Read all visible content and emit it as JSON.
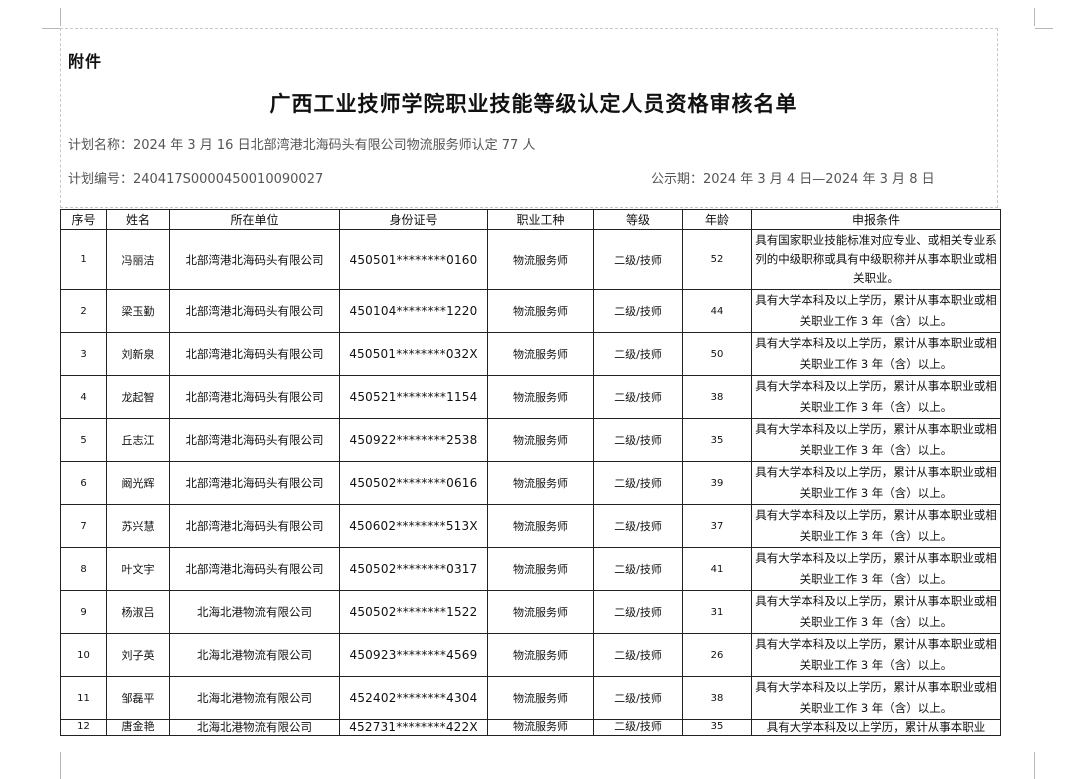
{
  "document": {
    "attachment_label": "附件",
    "title": "广西工业技师学院职业技能等级认定人员资格审核名单",
    "plan_name_label": "计划名称：",
    "plan_name": "2024 年 3 月 16 日北部湾港北海码头有限公司物流服务师认定 77 人",
    "plan_no_label": "计划编号：",
    "plan_no": "240417S0000450010090027",
    "period_label": "公示期：",
    "period": "2024 年 3 月 4 日—2024 年 3 月 8 日"
  },
  "table": {
    "columns": [
      "序号",
      "姓名",
      "所在单位",
      "身份证号",
      "职业工种",
      "等级",
      "年龄",
      "申报条件"
    ],
    "rows": [
      {
        "no": "1",
        "name": "冯丽洁",
        "unit": "北部湾港北海码头有限公司",
        "id": "450501********0160",
        "occupation": "物流服务师",
        "level": "二级/技师",
        "age": "52",
        "condition": "具有国家职业技能标准对应专业、或相关专业系列的中级职称或具有中级职称并从事本职业或相关职业。"
      },
      {
        "no": "2",
        "name": "梁玉勤",
        "unit": "北部湾港北海码头有限公司",
        "id": "450104********1220",
        "occupation": "物流服务师",
        "level": "二级/技师",
        "age": "44",
        "condition": "具有大学本科及以上学历，累计从事本职业或相关职业工作 3 年（含）以上。"
      },
      {
        "no": "3",
        "name": "刘新泉",
        "unit": "北部湾港北海码头有限公司",
        "id": "450501********032X",
        "occupation": "物流服务师",
        "level": "二级/技师",
        "age": "50",
        "condition": "具有大学本科及以上学历，累计从事本职业或相关职业工作 3 年（含）以上。"
      },
      {
        "no": "4",
        "name": "龙起智",
        "unit": "北部湾港北海码头有限公司",
        "id": "450521********1154",
        "occupation": "物流服务师",
        "level": "二级/技师",
        "age": "38",
        "condition": "具有大学本科及以上学历，累计从事本职业或相关职业工作 3 年（含）以上。"
      },
      {
        "no": "5",
        "name": "丘志江",
        "unit": "北部湾港北海码头有限公司",
        "id": "450922********2538",
        "occupation": "物流服务师",
        "level": "二级/技师",
        "age": "35",
        "condition": "具有大学本科及以上学历，累计从事本职业或相关职业工作 3 年（含）以上。"
      },
      {
        "no": "6",
        "name": "阚光辉",
        "unit": "北部湾港北海码头有限公司",
        "id": "450502********0616",
        "occupation": "物流服务师",
        "level": "二级/技师",
        "age": "39",
        "condition": "具有大学本科及以上学历，累计从事本职业或相关职业工作 3 年（含）以上。"
      },
      {
        "no": "7",
        "name": "苏兴慧",
        "unit": "北部湾港北海码头有限公司",
        "id": "450602********513X",
        "occupation": "物流服务师",
        "level": "二级/技师",
        "age": "37",
        "condition": "具有大学本科及以上学历，累计从事本职业或相关职业工作 3 年（含）以上。"
      },
      {
        "no": "8",
        "name": "叶文宇",
        "unit": "北部湾港北海码头有限公司",
        "id": "450502********0317",
        "occupation": "物流服务师",
        "level": "二级/技师",
        "age": "41",
        "condition": "具有大学本科及以上学历，累计从事本职业或相关职业工作 3 年（含）以上。"
      },
      {
        "no": "9",
        "name": "杨淑吕",
        "unit": "北海北港物流有限公司",
        "id": "450502********1522",
        "occupation": "物流服务师",
        "level": "二级/技师",
        "age": "31",
        "condition": "具有大学本科及以上学历，累计从事本职业或相关职业工作 3 年（含）以上。"
      },
      {
        "no": "10",
        "name": "刘子英",
        "unit": "北海北港物流有限公司",
        "id": "450923********4569",
        "occupation": "物流服务师",
        "level": "二级/技师",
        "age": "26",
        "condition": "具有大学本科及以上学历，累计从事本职业或相关职业工作 3 年（含）以上。"
      },
      {
        "no": "11",
        "name": "邹磊平",
        "unit": "北海北港物流有限公司",
        "id": "452402********4304",
        "occupation": "物流服务师",
        "level": "二级/技师",
        "age": "38",
        "condition": "具有大学本科及以上学历，累计从事本职业或相关职业工作 3 年（含）以上。"
      },
      {
        "no": "12",
        "name": "唐金艳",
        "unit": "北海北港物流有限公司",
        "id": "452731********422X",
        "occupation": "物流服务师",
        "level": "二级/技师",
        "age": "35",
        "condition": "具有大学本科及以上学历，累计从事本职业"
      }
    ]
  }
}
